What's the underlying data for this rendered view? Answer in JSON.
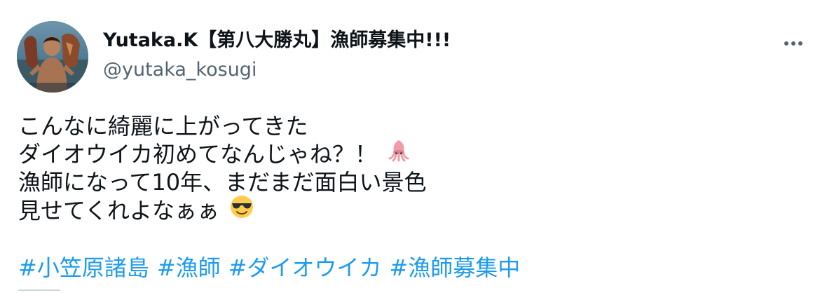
{
  "tweet": {
    "author": {
      "display_name": "Yutaka.K【第八大勝丸】漁師募集中!!!",
      "handle": "@yutaka_kosugi",
      "avatar_icon": "user-avatar"
    },
    "more_icon": "more-horizontal-icon",
    "body_lines": [
      "こんなに綺麗に上がってきた",
      "ダイオウイカ初めてなんじゃね？！",
      "漁師になって10年、まだまだ面白い景色",
      "見せてくれよなぁぁ"
    ],
    "emojis": {
      "squid": "squid-emoji-icon",
      "sunglasses": "smiling-face-with-sunglasses-icon"
    },
    "hashtags": [
      "#小笠原諸島",
      "#漁師",
      "#ダイオウイカ",
      "#漁師募集中"
    ]
  },
  "colors": {
    "text": "#0f1419",
    "secondary": "#536471",
    "link": "#1d9bf0",
    "background": "#ffffff"
  }
}
